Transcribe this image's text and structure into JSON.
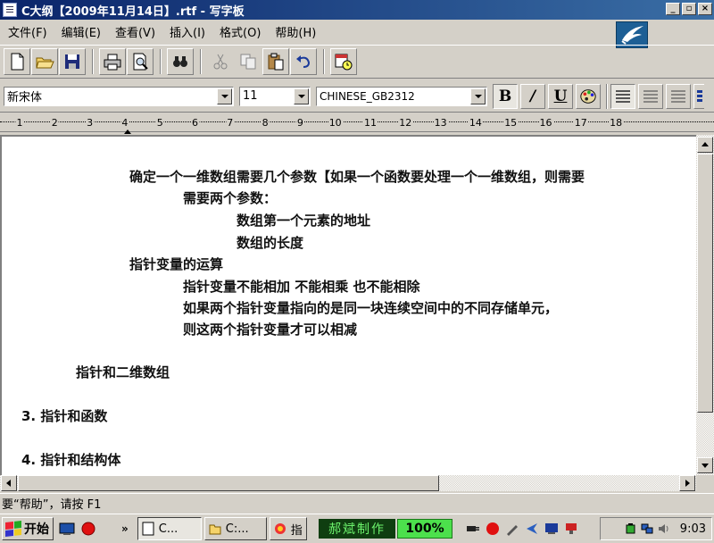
{
  "window": {
    "title": "C大纲【2009年11月14日】.rtf - 写字板",
    "minimize": "_",
    "maximize": "▫",
    "close": "×"
  },
  "menu": [
    {
      "label": "文件(F)"
    },
    {
      "label": "编辑(E)"
    },
    {
      "label": "查看(V)"
    },
    {
      "label": "插入(I)"
    },
    {
      "label": "格式(O)"
    },
    {
      "label": "帮助(H)"
    }
  ],
  "format": {
    "font": "新宋体",
    "size": "11",
    "script": "CHINESE_GB2312",
    "bold": "B",
    "italic": "/",
    "underline": "U"
  },
  "ruler": {
    "numbers": [
      "1",
      "2",
      "3",
      "4",
      "5",
      "6",
      "7",
      "8",
      "9",
      "10",
      "11",
      "12",
      "13",
      "14",
      "15",
      "16",
      "17",
      "18"
    ]
  },
  "document": {
    "lines": [
      "确定一个一维数组需要几个参数【如果一个函数要处理一个一维数组，则需要",
      "需要两个参数：",
      "数组第一个元素的地址",
      "数组的长度",
      "指针变量的运算",
      "指针变量不能相加  不能相乘  也不能相除",
      "如果两个指针变量指向的是同一块连续空间中的不同存储单元，",
      "则这两个指针变量才可以相减",
      "指针和二维数组",
      "3.  指针和函数",
      "4.  指针和结构体"
    ]
  },
  "status": {
    "text": "要“帮助”，请按 F1"
  },
  "taskbar": {
    "start": "开始",
    "more": "»",
    "tasks": [
      {
        "label": "C..."
      },
      {
        "label": "C:..."
      },
      {
        "label": "指"
      }
    ],
    "banner": "郝斌制作",
    "percent": "100%",
    "clock": "9:03"
  }
}
